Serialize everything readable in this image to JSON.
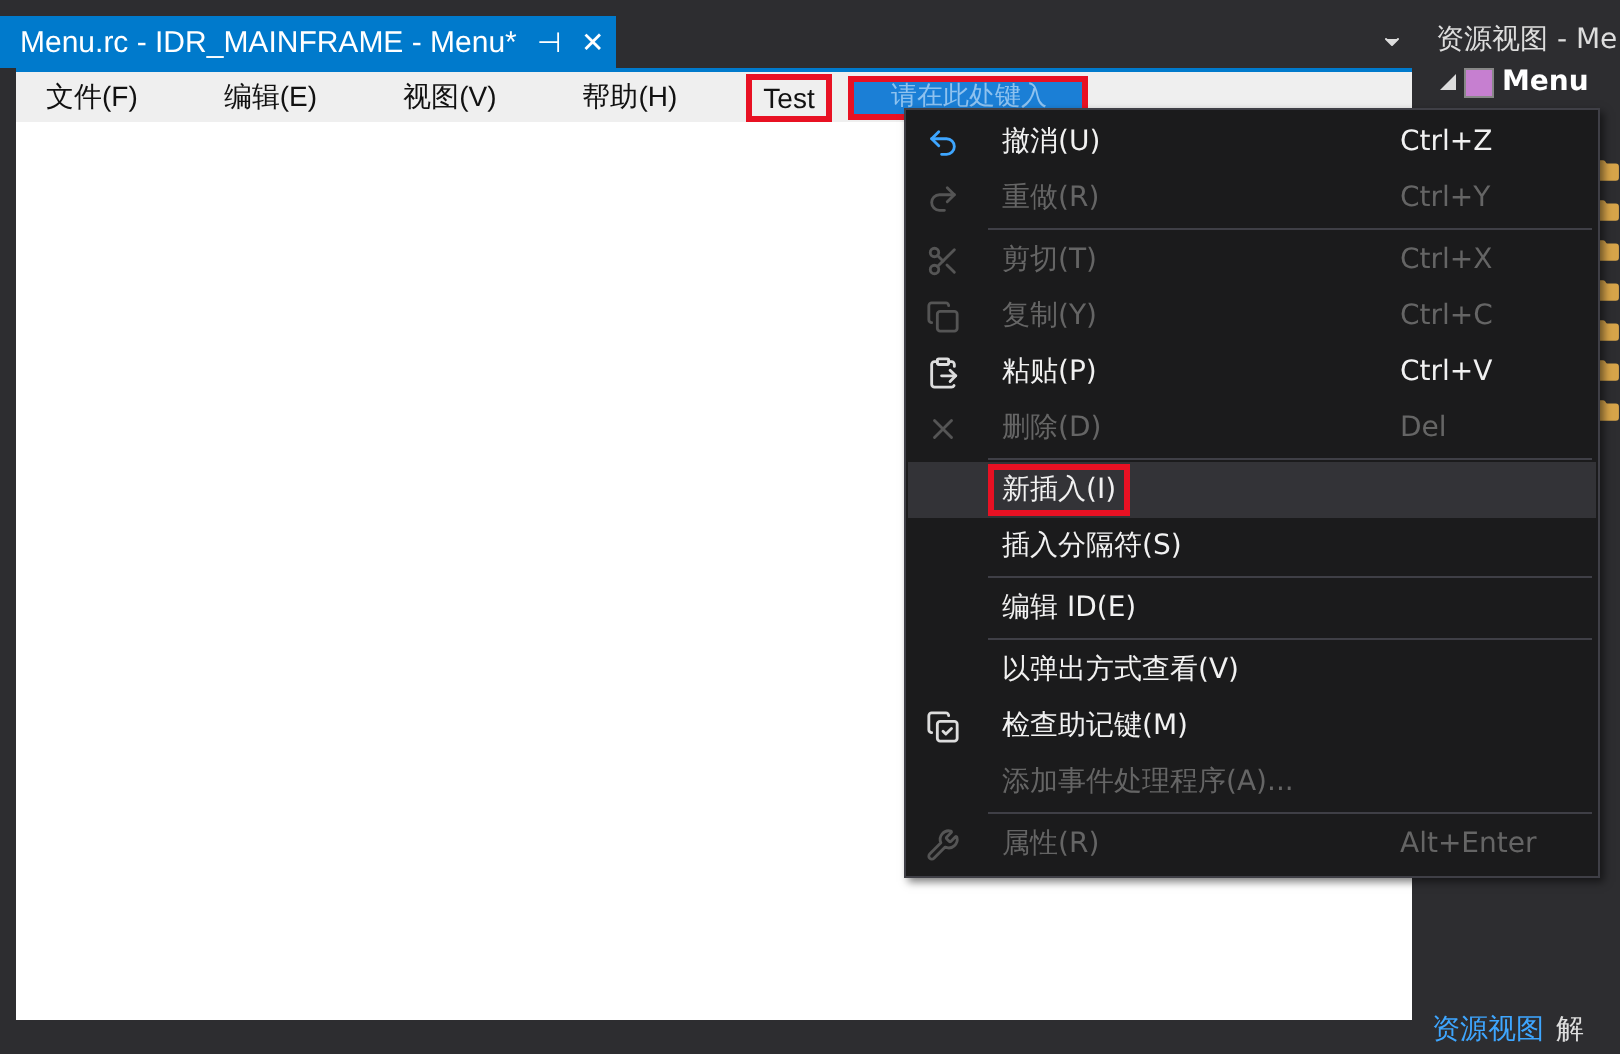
{
  "document_tab": {
    "title": "Menu.rc - IDR_MAINFRAME - Menu*",
    "pin": "⊣",
    "close": "✕"
  },
  "menu_bar": [
    {
      "label": "文件(F)",
      "annotated": false
    },
    {
      "label": "编辑(E)",
      "annotated": false
    },
    {
      "label": "视图(V)",
      "annotated": false
    },
    {
      "label": "帮助(H)",
      "annotated": false
    },
    {
      "label": "Test",
      "annotated": true
    }
  ],
  "type_here": {
    "label": "请在此处键入",
    "annotated": true
  },
  "context_menu": [
    {
      "kind": "item",
      "label": "撤消(U)",
      "shortcut": "Ctrl+Z",
      "disabled": false,
      "selected": false,
      "annotated": false
    },
    {
      "kind": "item",
      "label": "重做(R)",
      "shortcut": "Ctrl+Y",
      "disabled": true,
      "selected": false,
      "annotated": false
    },
    {
      "kind": "separator"
    },
    {
      "kind": "item",
      "label": "剪切(T)",
      "shortcut": "Ctrl+X",
      "disabled": true,
      "selected": false,
      "annotated": false
    },
    {
      "kind": "item",
      "label": "复制(Y)",
      "shortcut": "Ctrl+C",
      "disabled": true,
      "selected": false,
      "annotated": false
    },
    {
      "kind": "item",
      "label": "粘贴(P)",
      "shortcut": "Ctrl+V",
      "disabled": false,
      "selected": false,
      "annotated": false
    },
    {
      "kind": "item",
      "label": "删除(D)",
      "shortcut": "Del",
      "disabled": true,
      "selected": false,
      "annotated": false
    },
    {
      "kind": "separator"
    },
    {
      "kind": "item",
      "label": "新插入(I)",
      "disabled": false,
      "selected": true,
      "annotated": true
    },
    {
      "kind": "item",
      "label": "插入分隔符(S)",
      "disabled": false,
      "selected": false,
      "annotated": false
    },
    {
      "kind": "separator"
    },
    {
      "kind": "item",
      "label": "编辑 ID(E)",
      "disabled": false,
      "selected": false,
      "annotated": false
    },
    {
      "kind": "separator"
    },
    {
      "kind": "item",
      "label": "以弹出方式查看(V)",
      "disabled": false,
      "selected": false,
      "annotated": false
    },
    {
      "kind": "item",
      "label": "检查助记键(M)",
      "disabled": false,
      "selected": false,
      "annotated": false
    },
    {
      "kind": "item",
      "label": "添加事件处理程序(A)...",
      "disabled": true,
      "selected": false,
      "annotated": false
    },
    {
      "kind": "separator"
    },
    {
      "kind": "item",
      "label": "属性(R)",
      "shortcut": "Alt+Enter",
      "disabled": true,
      "selected": false,
      "annotated": false
    }
  ],
  "resource_view": {
    "title": "资源视图 - Me",
    "tree_root": {
      "label": "Menu",
      "expanded": true
    }
  },
  "bottom_tabs": [
    {
      "label": "资源视图",
      "selected": true
    },
    {
      "label": "解",
      "selected": false
    }
  ]
}
